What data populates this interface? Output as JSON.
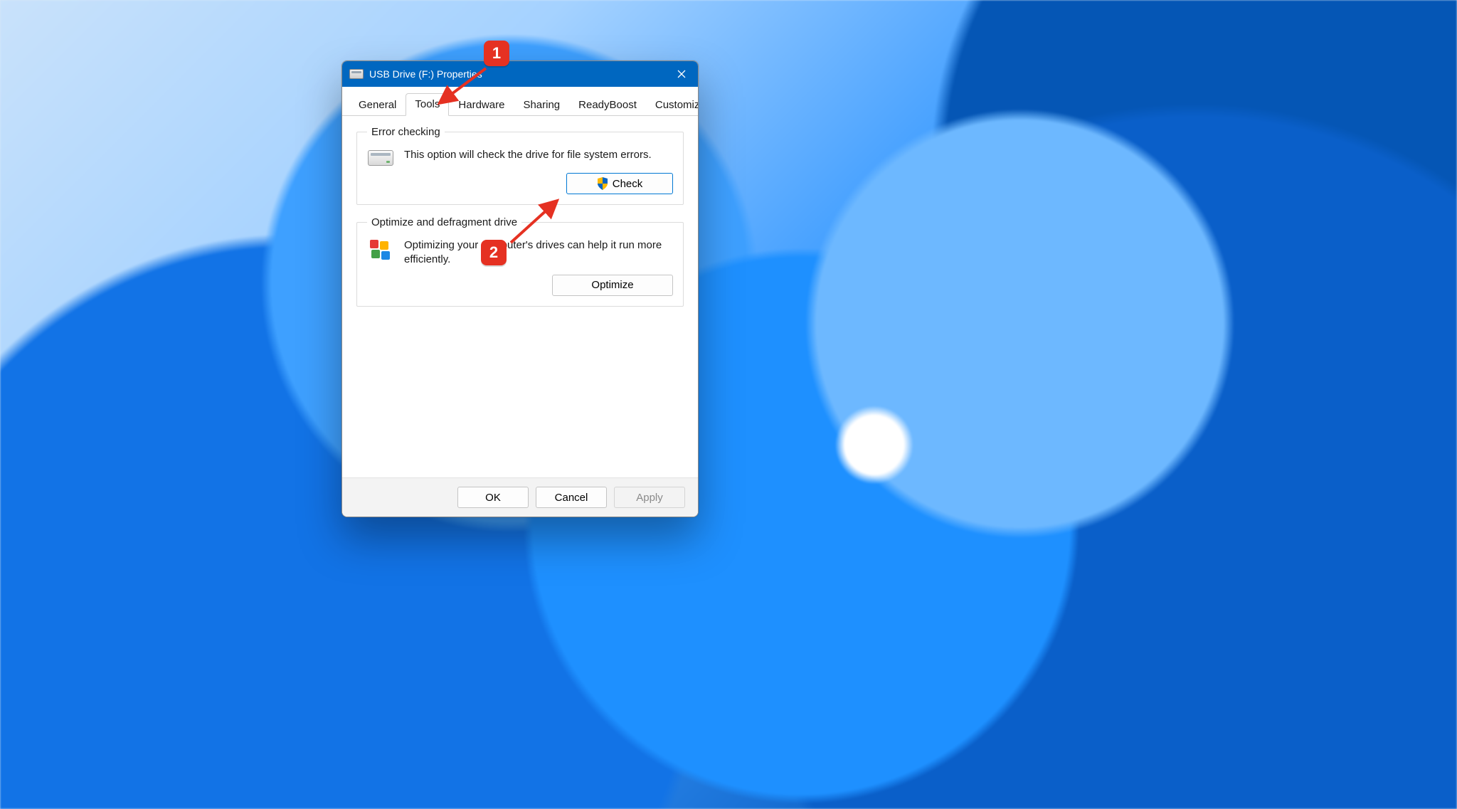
{
  "dialog": {
    "title": "USB Drive (F:) Properties",
    "tabs": [
      "General",
      "Tools",
      "Hardware",
      "Sharing",
      "ReadyBoost",
      "Customize"
    ],
    "activeTab": "Tools",
    "errorChecking": {
      "legend": "Error checking",
      "desc": "This option will check the drive for file system errors.",
      "button": "Check"
    },
    "optimize": {
      "legend": "Optimize and defragment drive",
      "desc": "Optimizing your computer's drives can help it run more efficiently.",
      "button": "Optimize"
    },
    "footer": {
      "ok": "OK",
      "cancel": "Cancel",
      "apply": "Apply"
    }
  },
  "callouts": {
    "one": "1",
    "two": "2"
  }
}
